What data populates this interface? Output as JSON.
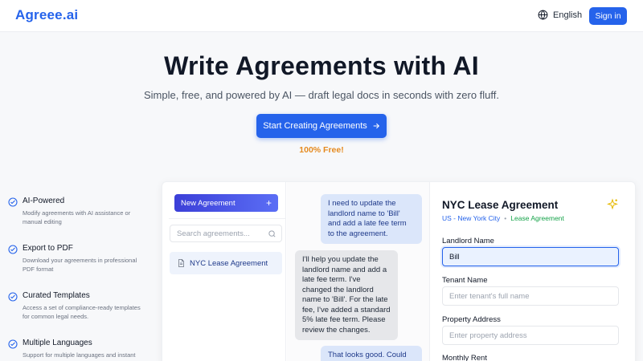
{
  "header": {
    "logo": "Agreee.ai",
    "language": "English",
    "signin": "Sign in"
  },
  "hero": {
    "title": "Write Agreements with AI",
    "subtitle": "Simple, free, and powered by AI — draft legal docs in seconds with zero fluff.",
    "cta": "Start Creating Agreements",
    "free": "100% Free!"
  },
  "features": [
    {
      "title": "AI-Powered",
      "desc": "Modify agreements with AI assistance or manual editing"
    },
    {
      "title": "Export to PDF",
      "desc": "Download your agreements in professional PDF format"
    },
    {
      "title": "Curated Templates",
      "desc": "Access a set of compliance-ready templates for common legal needs."
    },
    {
      "title": "Multiple Languages",
      "desc": "Support for multiple languages and instant translation"
    }
  ],
  "sidebar": {
    "new_agreement": "New Agreement",
    "new_plus": "+",
    "search_placeholder": "Search agreements...",
    "doc_item": "NYC Lease Agreement"
  },
  "chat": {
    "messages": [
      {
        "role": "user",
        "text": "I need to update the landlord name to 'Bill' and add a late fee term to the agreement."
      },
      {
        "role": "ai",
        "text": "I'll help you update the landlord name and add a late fee term. I've changed the landlord name to 'Bill'. For the late fee, I've added a standard 5% late fee term. Please review the changes."
      },
      {
        "role": "user",
        "text": "That looks good. Could"
      }
    ]
  },
  "form": {
    "title": "NYC Lease Agreement",
    "location": "US - New York City",
    "dot": "•",
    "type": "Lease Agreement",
    "landlord_label": "Landlord Name",
    "landlord_value": "Bill",
    "tenant_label": "Tenant Name",
    "tenant_placeholder": "Enter tenant's full name",
    "property_label": "Property Address",
    "property_placeholder": "Enter property address",
    "rent_label": "Monthly Rent"
  },
  "colors": {
    "primary": "#2563eb",
    "free": "#e58a1f",
    "location": "#2563eb",
    "type": "#16a34a"
  }
}
